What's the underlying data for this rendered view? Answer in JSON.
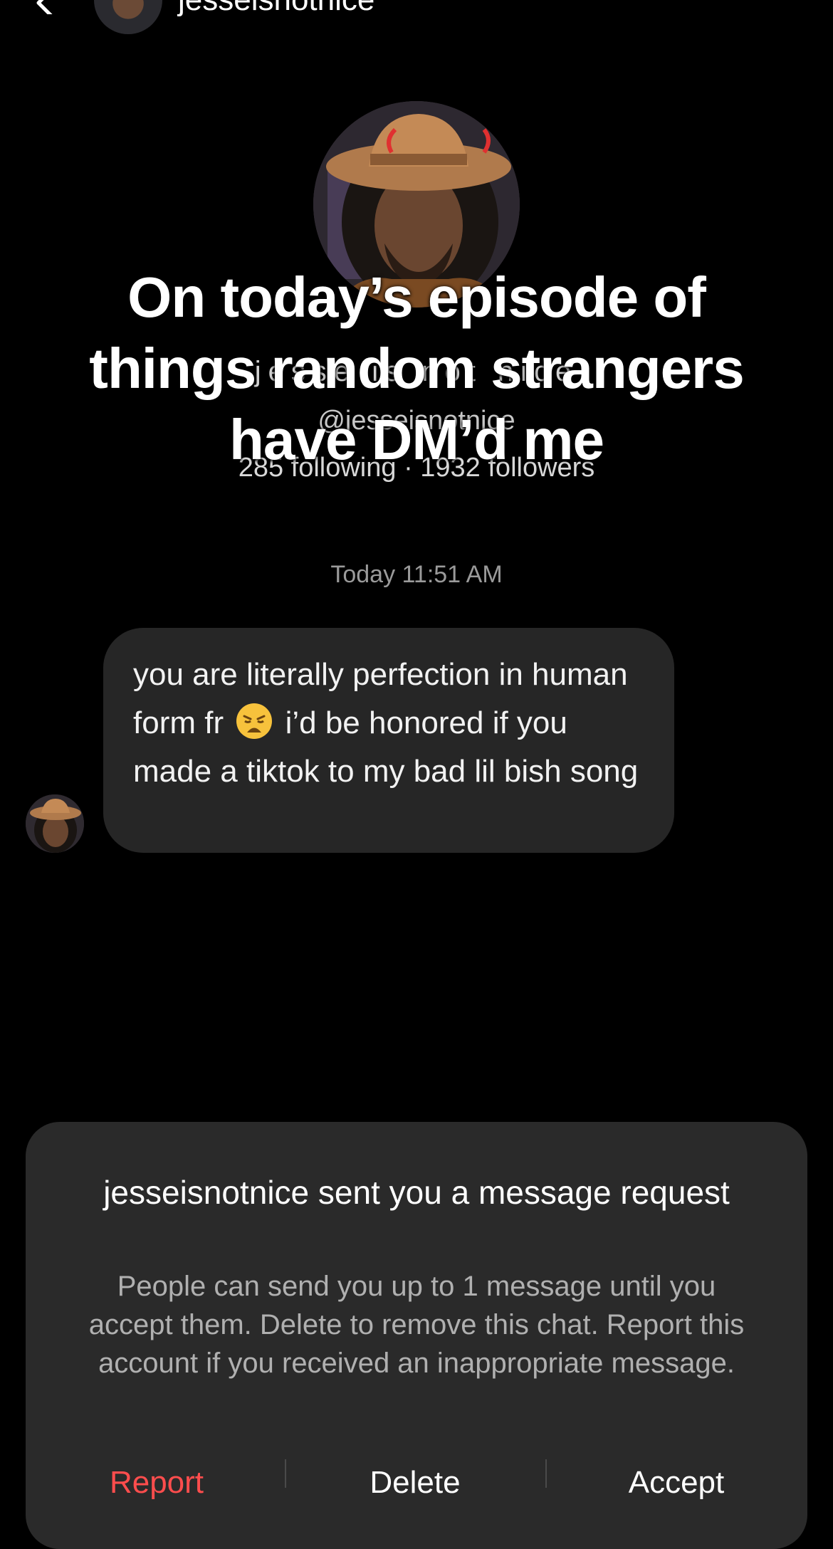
{
  "header": {
    "username": "jesseisnotnice",
    "back_icon": "chevron-left-icon",
    "more_icon": "more-horizontal-icon"
  },
  "profile": {
    "name": "jesse is not nice",
    "handle": "@jesseisnotnice",
    "stats": "285 following · 1932 followers"
  },
  "overlay": {
    "caption": "On today’s episode of things random strangers have DM’d me"
  },
  "conversation": {
    "timestamp": "Today 11:51 AM",
    "message": {
      "text_part1": "you are literally perfection in human form fr",
      "emoji": "weary-face-emoji",
      "text_part2": "i’d be honored if you made a tiktok to my bad lil bish song"
    }
  },
  "request_sheet": {
    "title": "jesseisnotnice sent you a message request",
    "body": "People can send you up to 1 message until you accept them. Delete to remove this chat. Report this account if you received an inappropriate message.",
    "actions": {
      "report": "Report",
      "delete": "Delete",
      "accept": "Accept"
    },
    "report_color": "#ff4d4d"
  }
}
